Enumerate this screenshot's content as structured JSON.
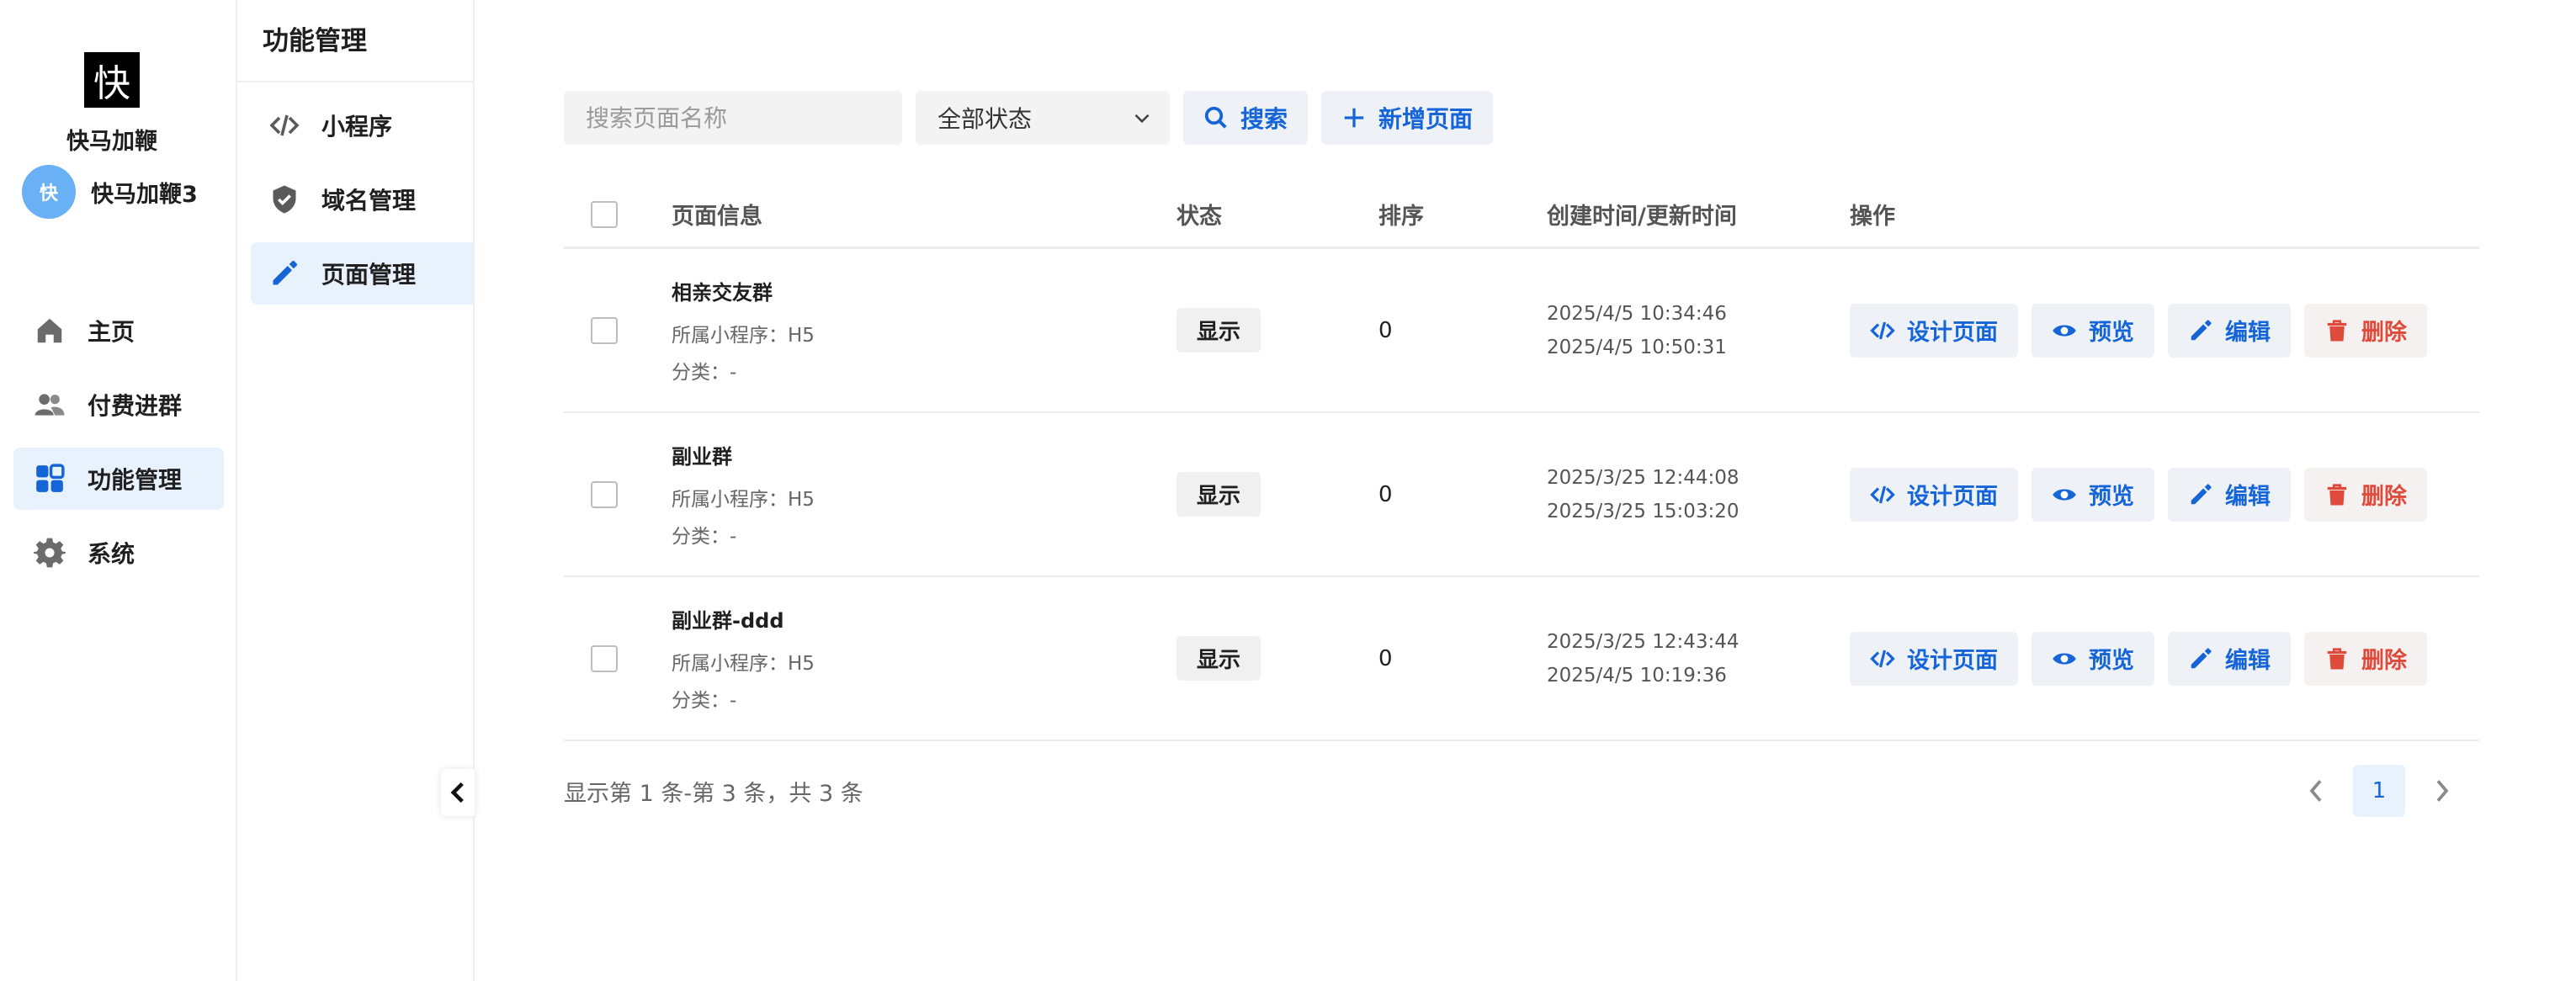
{
  "brand": {
    "logo_char": "快",
    "app_name": "快马加鞭"
  },
  "user": {
    "avatar_char": "快",
    "name": "快马加鞭3"
  },
  "nav": {
    "items": [
      {
        "label": "主页",
        "icon": "home-icon"
      },
      {
        "label": "付费进群",
        "icon": "users-icon"
      },
      {
        "label": "功能管理",
        "icon": "grid-icon",
        "active": true
      },
      {
        "label": "系统",
        "icon": "gear-icon"
      }
    ]
  },
  "subnav": {
    "title": "功能管理",
    "items": [
      {
        "label": "小程序",
        "icon": "code-icon"
      },
      {
        "label": "域名管理",
        "icon": "shield-icon"
      },
      {
        "label": "页面管理",
        "icon": "pencil-icon",
        "active": true
      }
    ]
  },
  "toolbar": {
    "search_placeholder": "搜索页面名称",
    "search_value": "",
    "status_selected": "全部状态",
    "search_label": "搜索",
    "add_label": "新增页面"
  },
  "table": {
    "headers": {
      "info": "页面信息",
      "status": "状态",
      "sort": "排序",
      "time": "创建时间/更新时间",
      "ops": "操作"
    },
    "rows": [
      {
        "name": "相亲交友群",
        "program": "所属小程序：H5",
        "category": "分类：-",
        "status": "显示",
        "sort": "0",
        "created": "2025/4/5 10:34:46",
        "updated": "2025/4/5 10:50:31"
      },
      {
        "name": "副业群",
        "program": "所属小程序：H5",
        "category": "分类：-",
        "status": "显示",
        "sort": "0",
        "created": "2025/3/25 12:44:08",
        "updated": "2025/3/25 15:03:20"
      },
      {
        "name": "副业群-ddd",
        "program": "所属小程序：H5",
        "category": "分类：-",
        "status": "显示",
        "sort": "0",
        "created": "2025/3/25 12:43:44",
        "updated": "2025/4/5 10:19:36"
      }
    ],
    "ops": {
      "design": "设计页面",
      "preview": "预览",
      "edit": "编辑",
      "delete": "删除"
    }
  },
  "pagination": {
    "range_text": "显示第 1 条-第 3 条，共 3 条",
    "current_page": "1"
  },
  "colors": {
    "accent": "#1565d8",
    "danger": "#e04a3a",
    "active_bg": "#e8f2fd"
  }
}
